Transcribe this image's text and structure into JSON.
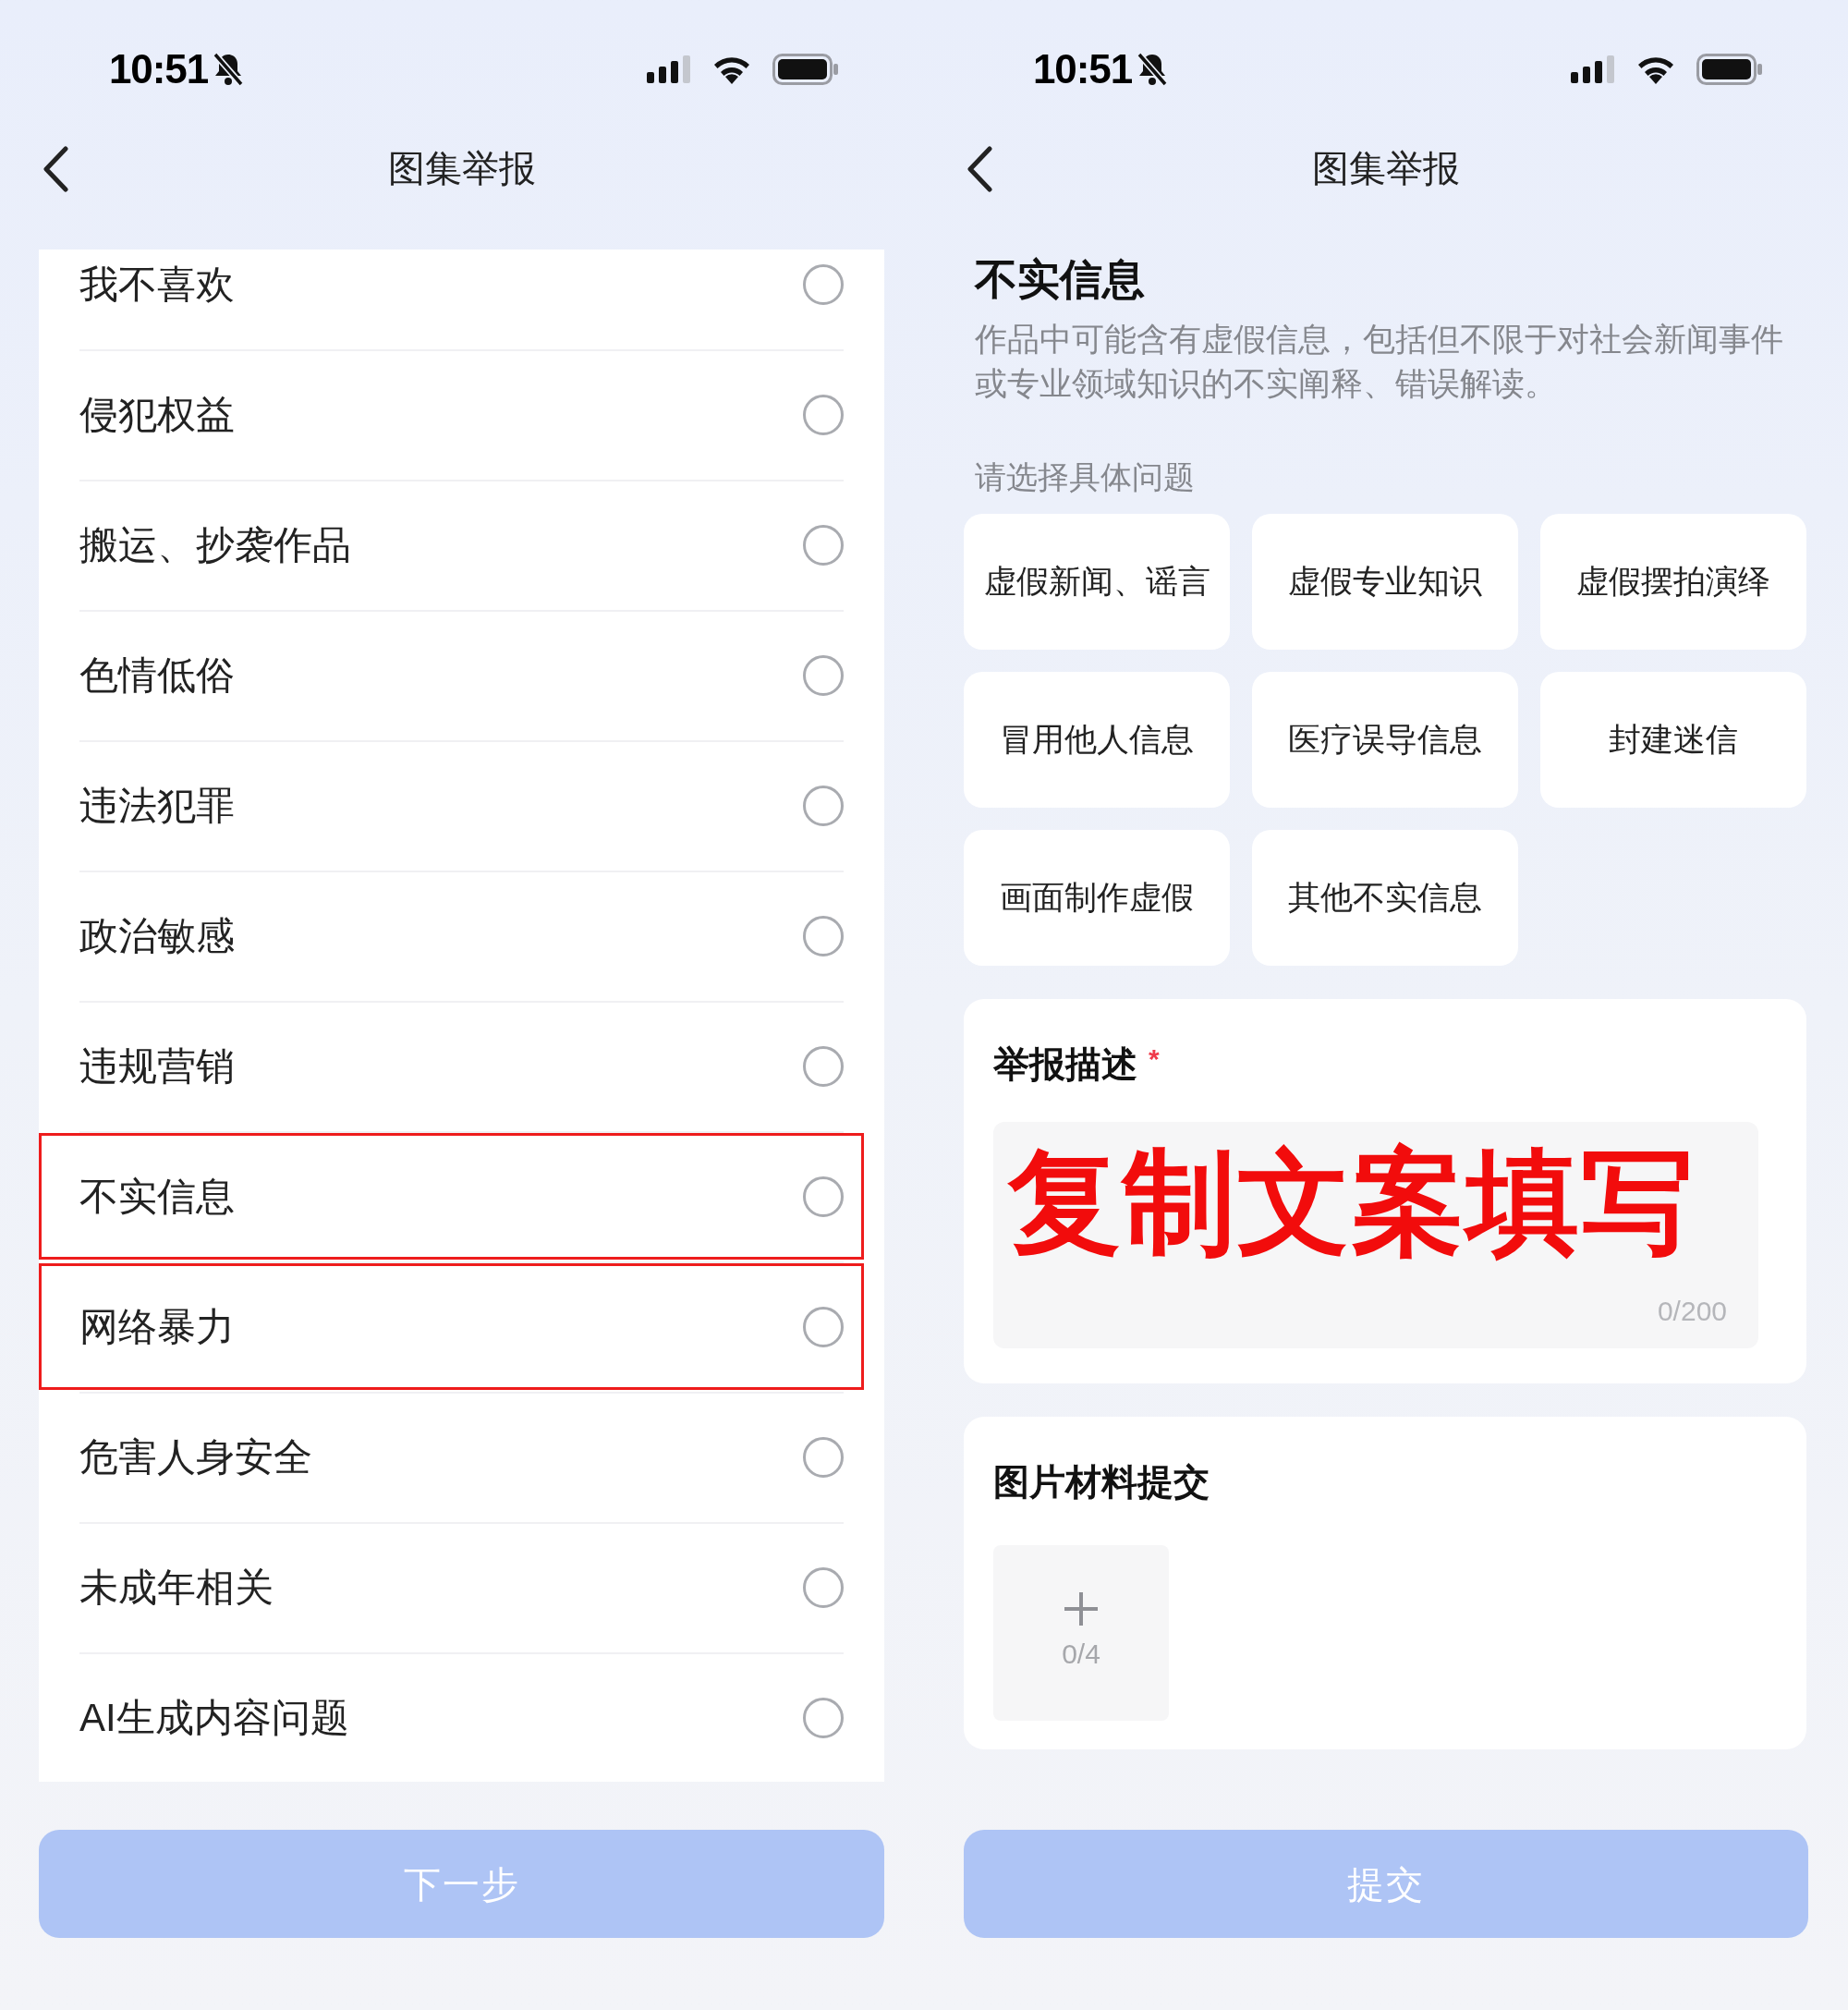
{
  "screens": [
    {
      "status_bar": {
        "time": "10:51"
      },
      "nav": {
        "title": "图集举报"
      },
      "reasons": [
        {
          "label": "我不喜欢",
          "selected": false,
          "highlighted": false
        },
        {
          "label": "侵犯权益",
          "selected": false,
          "highlighted": false
        },
        {
          "label": "搬运、抄袭作品",
          "selected": false,
          "highlighted": false
        },
        {
          "label": "色情低俗",
          "selected": false,
          "highlighted": false
        },
        {
          "label": "违法犯罪",
          "selected": false,
          "highlighted": false
        },
        {
          "label": "政治敏感",
          "selected": false,
          "highlighted": false
        },
        {
          "label": "违规营销",
          "selected": false,
          "highlighted": false
        },
        {
          "label": "不实信息",
          "selected": false,
          "highlighted": true
        },
        {
          "label": "网络暴力",
          "selected": false,
          "highlighted": true
        },
        {
          "label": "危害人身安全",
          "selected": false,
          "highlighted": false
        },
        {
          "label": "未成年相关",
          "selected": false,
          "highlighted": false
        },
        {
          "label": "AI生成内容问题",
          "selected": false,
          "highlighted": false
        }
      ],
      "button": {
        "label": "下一步",
        "disabled": true
      }
    },
    {
      "status_bar": {
        "time": "10:51"
      },
      "nav": {
        "title": "图集举报"
      },
      "category": {
        "title": "不实信息",
        "description": "作品中可能含有虚假信息，包括但不限于对社会新闻事件或专业领域知识的不实阐释、错误解读。"
      },
      "issue_prompt": "请选择具体问题",
      "issues": [
        {
          "label": "虚假新闻、谣言",
          "selected": false
        },
        {
          "label": "虚假专业知识",
          "selected": false
        },
        {
          "label": "虚假摆拍演绎",
          "selected": false
        },
        {
          "label": "冒用他人信息",
          "selected": false
        },
        {
          "label": "医疗误导信息",
          "selected": false
        },
        {
          "label": "封建迷信",
          "selected": false
        },
        {
          "label": "画面制作虚假",
          "selected": false
        },
        {
          "label": "其他不实信息",
          "selected": false
        }
      ],
      "report_description": {
        "title": "举报描述",
        "required_mark": "*",
        "counter": "0/200",
        "overlay_annotation": "复制文案填写"
      },
      "image_upload": {
        "title": "图片材料提交",
        "counter": "0/4"
      },
      "button": {
        "label": "提交",
        "disabled": true
      }
    }
  ]
}
